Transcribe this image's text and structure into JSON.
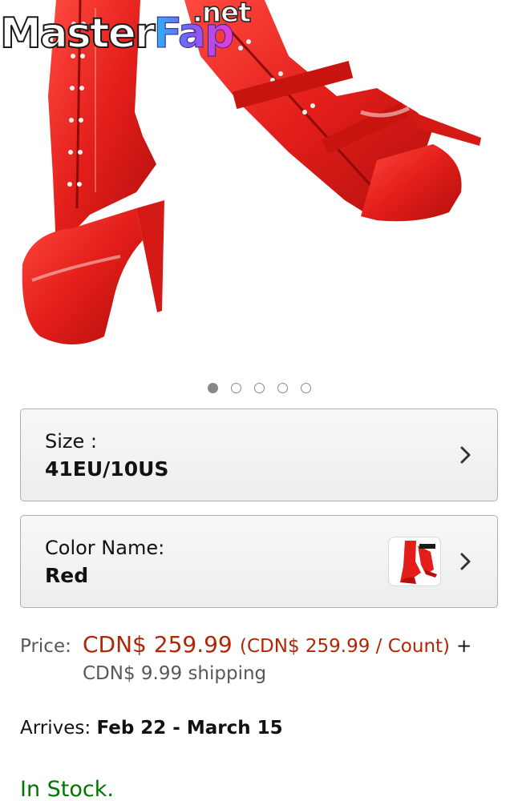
{
  "watermark": {
    "part1": "Master",
    "part2": "Fap",
    "suffix": ".net"
  },
  "product_image": {
    "description_icon": "red-thigh-high-platform-boots-image"
  },
  "carousel": {
    "total": 5,
    "active_index": 0
  },
  "size": {
    "label": "Size :",
    "value": "41EU/10US"
  },
  "color": {
    "label": "Color Name:",
    "value": "Red"
  },
  "price": {
    "label": "Price:",
    "amount": "CDN$ 259.99",
    "unit_price": "(CDN$ 259.99 / Count)",
    "plus": "+",
    "shipping": "CDN$ 9.99 shipping"
  },
  "delivery": {
    "label": "Arrives:",
    "dates": "Feb 22 - March 15"
  },
  "availability": {
    "text": "In Stock."
  },
  "colors": {
    "price_red": "#b12704",
    "stock_green": "#007600",
    "boot_red": "#e8231f"
  }
}
